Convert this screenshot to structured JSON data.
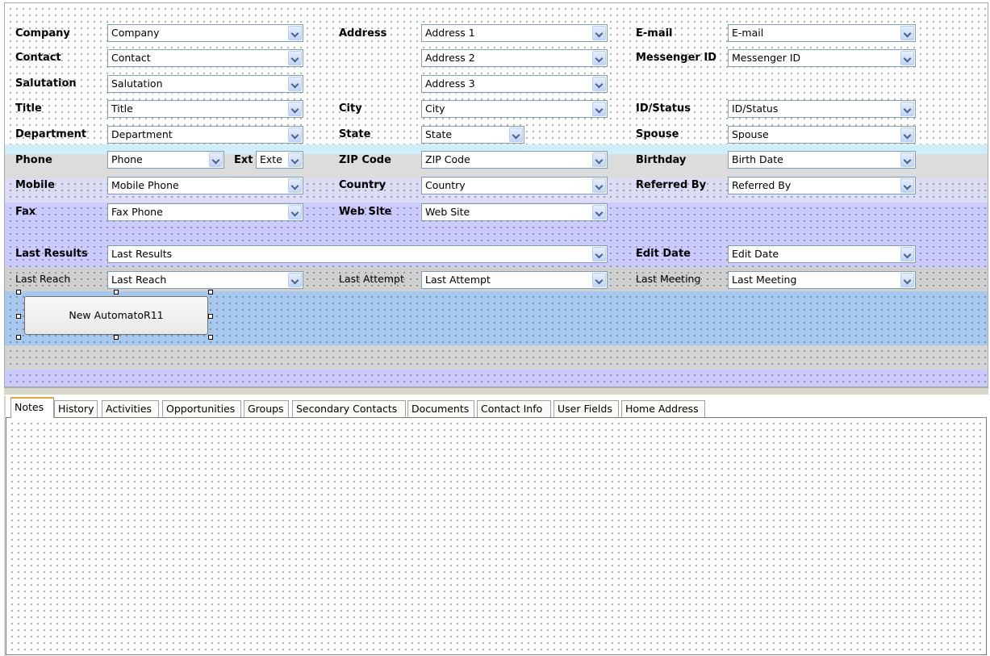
{
  "colors": {
    "band_light_blue": "#cfeefa",
    "band_lavender": "#cbcbff",
    "band_gray": "#cfcfcf",
    "band_blue": "#a7c8ee",
    "tab_accent": "#e8a33b"
  },
  "labels": {
    "company": "Company",
    "contact": "Contact",
    "salutation": "Salutation",
    "title": "Title",
    "department": "Department",
    "phone": "Phone",
    "ext": "Ext",
    "mobile": "Mobile",
    "fax": "Fax",
    "last_results": "Last Results",
    "last_reach": "Last Reach",
    "address": "Address",
    "city": "City",
    "state": "State",
    "zip": "ZIP Code",
    "country": "Country",
    "website": "Web Site",
    "last_attempt": "Last Attempt",
    "email": "E-mail",
    "messenger": "Messenger ID",
    "idstatus": "ID/Status",
    "spouse": "Spouse",
    "birthday": "Birthday",
    "referred": "Referred By",
    "edit_date": "Edit Date",
    "last_meeting": "Last Meeting"
  },
  "fields": {
    "company": "Company",
    "contact": "Contact",
    "salutation": "Salutation",
    "title": "Title",
    "department": "Department",
    "phone": "Phone",
    "ext": "Exte",
    "mobile": "Mobile Phone",
    "fax": "Fax Phone",
    "last_results": "Last Results",
    "last_reach": "Last Reach",
    "address1": "Address 1",
    "address2": "Address 2",
    "address3": "Address 3",
    "city": "City",
    "state": "State",
    "zip": "ZIP Code",
    "country": "Country",
    "website": "Web Site",
    "last_attempt": "Last Attempt",
    "email": "E-mail",
    "messenger": "Messenger ID",
    "idstatus": "ID/Status",
    "spouse": "Spouse",
    "birthday": "Birth Date",
    "referred": "Referred By",
    "edit_date": "Edit Date",
    "last_meeting": "Last Meeting"
  },
  "button": {
    "label": "New AutomatoR11"
  },
  "tabs": [
    "Notes",
    "History",
    "Activities",
    "Opportunities",
    "Groups",
    "Secondary Contacts",
    "Documents",
    "Contact Info",
    "User Fields",
    "Home Address"
  ]
}
